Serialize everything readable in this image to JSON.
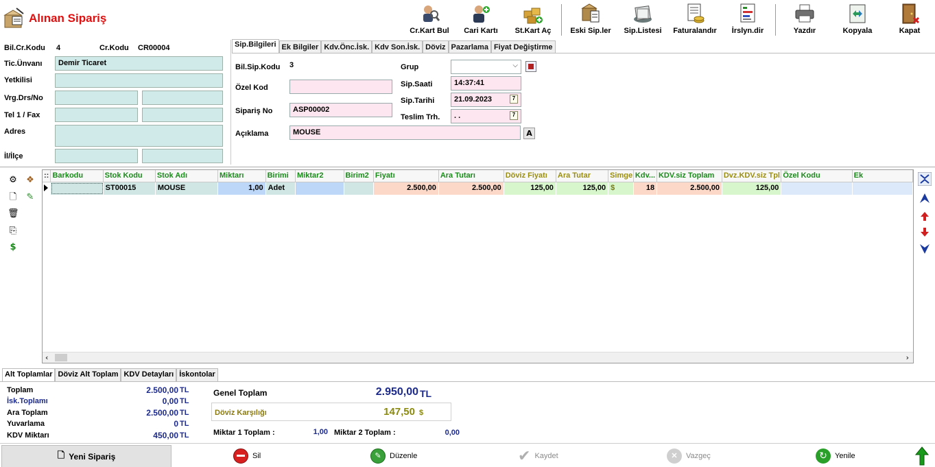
{
  "title": "Alınan Sipariş",
  "toolbar": [
    {
      "label": "Cr.Kart Bul",
      "icon": "find-account-icon"
    },
    {
      "label": "Cari Kartı",
      "icon": "account-card-icon"
    },
    {
      "label": "St.Kart Aç",
      "icon": "stock-card-icon"
    },
    {
      "label": "Eski Sip.ler",
      "icon": "old-orders-icon"
    },
    {
      "label": "Sip.Listesi",
      "icon": "order-list-icon"
    },
    {
      "label": "Faturalandır",
      "icon": "invoice-icon"
    },
    {
      "label": "İrslyn.dir",
      "icon": "waybill-icon"
    },
    {
      "label": "Yazdır",
      "icon": "printer-icon"
    },
    {
      "label": "Kopyala",
      "icon": "copy-icon"
    },
    {
      "label": "Kapat",
      "icon": "close-door-icon"
    }
  ],
  "customer": {
    "bil_cr_kodu_label": "Bil.Cr.Kodu",
    "bil_cr_kodu": "4",
    "cr_kodu_label": "Cr.Kodu",
    "cr_kodu": "CR00004",
    "unvan_label": "Tic.Ünvanı",
    "unvan": "Demir Ticaret",
    "yetkili_label": "Yetkilisi",
    "vergi_label": "Vrg.Drs/No",
    "tel_label": "Tel 1 / Fax",
    "adres_label": "Adres",
    "il_label": "İl/İlçe"
  },
  "tabs": [
    "Sip.Bilgileri",
    "Ek Bilgiler",
    "Kdv.Önc.İsk.",
    "Kdv Son.İsk.",
    "Döviz",
    "Pazarlama",
    "Fiyat Değiştirme"
  ],
  "order": {
    "bil_sip_kodu_label": "Bil.Sip.Kodu",
    "bil_sip_kodu": "3",
    "ozel_kod_label": "Özel Kod",
    "siparis_no_label": "Sipariş No",
    "siparis_no": "ASP00002",
    "aciklama_label": "Açıklama",
    "aciklama": "MOUSE",
    "grup_label": "Grup",
    "saat_label": "Sip.Saati",
    "saat": "14:37:41",
    "tarih_label": "Sip.Tarihi",
    "tarih": "21.09.2023",
    "teslim_label": "Teslim Trh.",
    "teslim": ". .",
    "a_button": "A"
  },
  "grid": {
    "columns": [
      "::",
      "Barkodu",
      "Stok Kodu",
      "Stok Adı",
      "Miktarı",
      "Birimi",
      "Miktar2",
      "Birim2",
      "Fiyatı",
      "Ara Tutarı",
      "Döviz Fiyatı",
      "Ara Tutar",
      "Simge",
      "Kdv...",
      "KDV.siz Toplam",
      "Dvz.KDV.siz Tpl.",
      "Özel Kodu",
      "Ek"
    ],
    "row": {
      "barkod": "",
      "stok_kodu": "ST00015",
      "stok_adi": "MOUSE",
      "miktar": "1,00",
      "birim": "Adet",
      "miktar2": "",
      "birim2": "",
      "fiyat": "2.500,00",
      "ara_tutar": "2.500,00",
      "doviz_fiyat": "125,00",
      "ara_tutar2": "125,00",
      "simge": "$",
      "kdv": "18",
      "kdv_siz_toplam": "2.500,00",
      "dvz_kdv_siz": "125,00",
      "ozel_kod": ""
    }
  },
  "bottom_tabs": [
    "Alt Toplamlar",
    "Döviz Alt Toplam",
    "KDV Detayları",
    "İskontolar"
  ],
  "totals": {
    "toplam_label": "Toplam",
    "toplam": "2.500,00",
    "isk_label": "İsk.Toplamı",
    "isk": "0,00",
    "ara_label": "Ara Toplam",
    "ara": "2.500,00",
    "yuv_label": "Yuvarlama",
    "yuv": "0",
    "kdv_label": "KDV Miktarı",
    "kdv": "450,00",
    "currency": "TL",
    "genel_label": "Genel Toplam",
    "genel": "2.950,00",
    "doviz_label": "Döviz Karşılığı",
    "doviz": "147,50",
    "doviz_symbol": "$",
    "miktar1_label": "Miktar 1 Toplam :",
    "miktar1": "1,00",
    "miktar2_label": "Miktar 2 Toplam :",
    "miktar2": "0,00"
  },
  "actions": {
    "new": "Yeni Sipariş",
    "delete": "Sil",
    "edit": "Düzenle",
    "save": "Kaydet",
    "cancel": "Vazgeç",
    "refresh": "Yenile"
  },
  "colors": {
    "title": "#e01010",
    "header_green": "#1a8a1a",
    "total_blue": "#1c2a8c",
    "doviz_olive": "#8a8a10"
  }
}
